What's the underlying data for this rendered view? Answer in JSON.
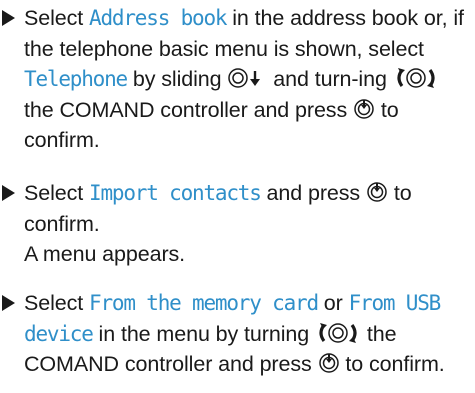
{
  "steps": [
    {
      "parts": [
        "Select ",
        "Address book",
        " in the address book or, if the telephone basic menu is shown, select ",
        "Telephone",
        " by sliding ",
        " and turn-ing ",
        " the COMAND controller and press ",
        " to confirm."
      ]
    },
    {
      "parts": [
        "Select ",
        "Import contacts",
        " and press ",
        " to confirm."
      ],
      "result": "A menu appears."
    },
    {
      "parts": [
        "Select ",
        "From the memory card",
        " or ",
        "From USB device",
        " in the menu by turning ",
        " the COMAND controller and press ",
        " to confirm."
      ]
    }
  ],
  "icons": {
    "slide": "slide-down-controller-icon",
    "turn": "turn-controller-icon",
    "press": "press-controller-icon"
  },
  "colors": {
    "menu_text": "#2f8fc9",
    "body_text": "#1a1a1a"
  }
}
